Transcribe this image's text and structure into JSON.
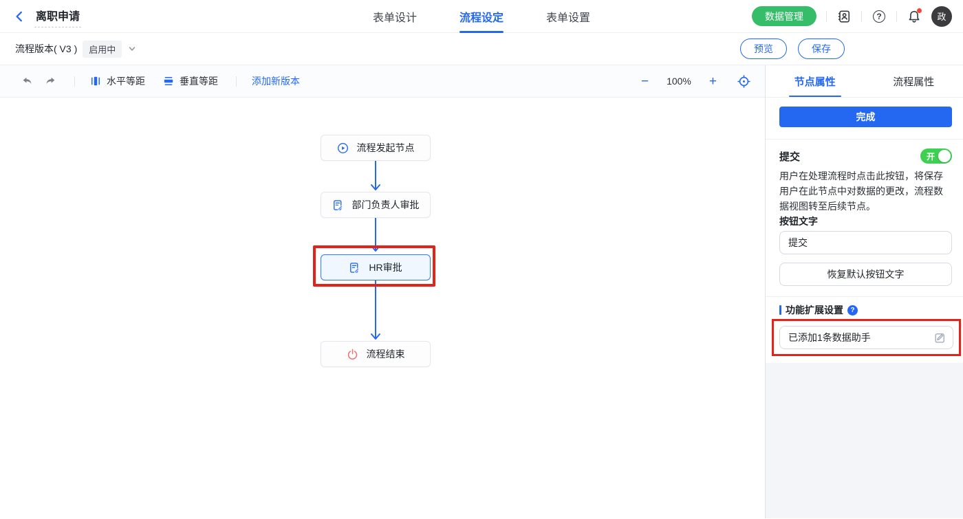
{
  "header": {
    "title": "离职申请",
    "tabs": [
      {
        "label": "表单设计"
      },
      {
        "label": "流程设定"
      },
      {
        "label": "表单设置"
      }
    ],
    "data_manage_button": "数据管理",
    "help_glyph": "?",
    "avatar_text": "政"
  },
  "subheader": {
    "version_label": "流程版本( V3 )",
    "status_badge": "启用中",
    "preview_button": "预览",
    "save_button": "保存"
  },
  "toolbar": {
    "horizontal_distribute": "水平等距",
    "vertical_distribute": "垂直等距",
    "add_version": "添加新版本",
    "zoom_out": "−",
    "zoom_level": "100%",
    "zoom_in": "+"
  },
  "flow": {
    "nodes": [
      {
        "label": "流程发起节点",
        "icon": "play-circle-icon"
      },
      {
        "label": "部门负责人审批",
        "icon": "approval-doc-icon"
      },
      {
        "label": "HR审批",
        "icon": "approval-doc-icon",
        "selected": true,
        "annotated": true
      },
      {
        "label": "流程结束",
        "icon": "power-icon"
      }
    ]
  },
  "panel": {
    "tabs": [
      {
        "label": "节点属性"
      },
      {
        "label": "流程属性"
      }
    ],
    "done_button": "完成",
    "submit_section": {
      "label": "提交",
      "toggle_state": "开",
      "description": "用户在处理流程时点击此按钮，将保存用户在此节点中对数据的更改，流程数据视图转至后续节点。",
      "button_text_label": "按钮文字",
      "button_text_value": "提交",
      "reset_button": "恢复默认按钮文字"
    },
    "extension_section": {
      "title": "功能扩展设置",
      "help_glyph": "?",
      "assistant_value": "已添加1条数据助手"
    }
  },
  "colors": {
    "primary_blue": "#2468f2",
    "green": "#35bd6a",
    "toggle_green": "#3ecf53",
    "annotation_red": "#e0241a",
    "end_node_red": "#f56c6c"
  }
}
